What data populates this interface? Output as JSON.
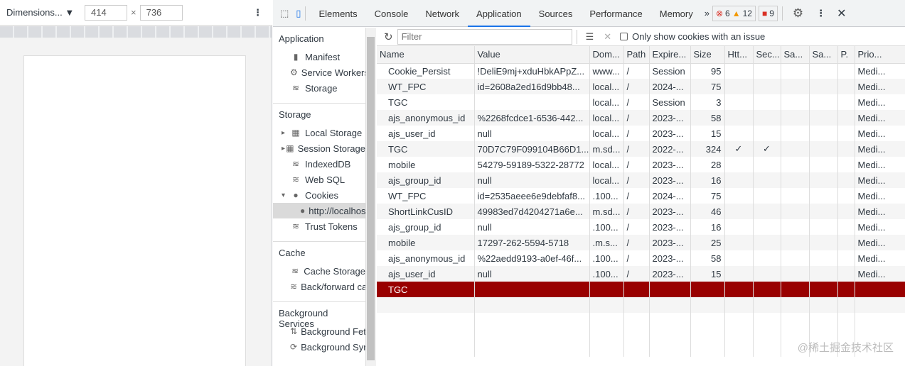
{
  "device": {
    "preset": "Dimensions...",
    "width": "414",
    "height": "736",
    "times": "×"
  },
  "tabs": [
    "Elements",
    "Console",
    "Network",
    "Application",
    "Sources",
    "Performance",
    "Memory"
  ],
  "active_tab": "Application",
  "badges": {
    "errors": "6",
    "warnings": "12",
    "issues": "9"
  },
  "sidebar": {
    "application": {
      "title": "Application",
      "items": [
        "Manifest",
        "Service Workers",
        "Storage"
      ]
    },
    "storage": {
      "title": "Storage",
      "items": [
        "Local Storage",
        "Session Storage",
        "IndexedDB",
        "Web SQL",
        "Cookies",
        "http://localhost",
        "Trust Tokens"
      ]
    },
    "cache": {
      "title": "Cache",
      "items": [
        "Cache Storage",
        "Back/forward cache"
      ]
    },
    "background": {
      "title": "Background Services",
      "items": [
        "Background Fetch",
        "Background Sync"
      ]
    }
  },
  "toolbar": {
    "filter_placeholder": "Filter",
    "only_issues_label": "Only show cookies with an issue",
    "only_issues_checked": false
  },
  "columns": [
    "Name",
    "Value",
    "Dom...",
    "Path",
    "Expire...",
    "Size",
    "Htt...",
    "Sec...",
    "Sa...",
    "Sa...",
    "P.",
    "Prio..."
  ],
  "rows": [
    [
      "Cookie_Persist",
      "!DeliE9mj+xduHbkAPpZ...",
      "www...",
      "/",
      "Session",
      "95",
      "",
      "",
      "",
      "",
      "",
      "Medi..."
    ],
    [
      "WT_FPC",
      "id=2608a2ed16d9bb48...",
      "local...",
      "/",
      "2024-...",
      "75",
      "",
      "",
      "",
      "",
      "",
      "Medi..."
    ],
    [
      "TGC",
      "",
      "local...",
      "/",
      "Session",
      "3",
      "",
      "",
      "",
      "",
      "",
      "Medi..."
    ],
    [
      "ajs_anonymous_id",
      "%2268fcdce1-6536-442...",
      "local...",
      "/",
      "2023-...",
      "58",
      "",
      "",
      "",
      "",
      "",
      "Medi..."
    ],
    [
      "ajs_user_id",
      "null",
      "local...",
      "/",
      "2023-...",
      "15",
      "",
      "",
      "",
      "",
      "",
      "Medi..."
    ],
    [
      "TGC",
      "70D7C79F099104B66D1...",
      "m.sd...",
      "/",
      "2022-...",
      "324",
      "✓",
      "✓",
      "",
      "",
      "",
      "Medi..."
    ],
    [
      "mobile",
      "54279-59189-5322-28772",
      "local...",
      "/",
      "2023-...",
      "28",
      "",
      "",
      "",
      "",
      "",
      "Medi..."
    ],
    [
      "ajs_group_id",
      "null",
      "local...",
      "/",
      "2023-...",
      "16",
      "",
      "",
      "",
      "",
      "",
      "Medi..."
    ],
    [
      "WT_FPC",
      "id=2535aeee6e9debfaf8...",
      ".100...",
      "/",
      "2024-...",
      "75",
      "",
      "",
      "",
      "",
      "",
      "Medi..."
    ],
    [
      "ShortLinkCusID",
      "49983ed7d4204271a6e...",
      "m.sd...",
      "/",
      "2023-...",
      "46",
      "",
      "",
      "",
      "",
      "",
      "Medi..."
    ],
    [
      "ajs_group_id",
      "null",
      ".100...",
      "/",
      "2023-...",
      "16",
      "",
      "",
      "",
      "",
      "",
      "Medi..."
    ],
    [
      "mobile",
      "17297-262-5594-5718",
      ".m.s...",
      "/",
      "2023-...",
      "25",
      "",
      "",
      "",
      "",
      "",
      "Medi..."
    ],
    [
      "ajs_anonymous_id",
      "%22aedd9193-a0ef-46f...",
      ".100...",
      "/",
      "2023-...",
      "58",
      "",
      "",
      "",
      "",
      "",
      "Medi..."
    ],
    [
      "ajs_user_id",
      "null",
      ".100...",
      "/",
      "2023-...",
      "15",
      "",
      "",
      "",
      "",
      "",
      "Medi..."
    ],
    [
      "TGC",
      "",
      "",
      "",
      "",
      "",
      "",
      "",
      "",
      "",
      "",
      ""
    ]
  ],
  "selected_row": 14,
  "watermark": "@稀土掘金技术社区",
  "colors": {
    "accent": "#1a73e8",
    "selected": "#990000"
  }
}
